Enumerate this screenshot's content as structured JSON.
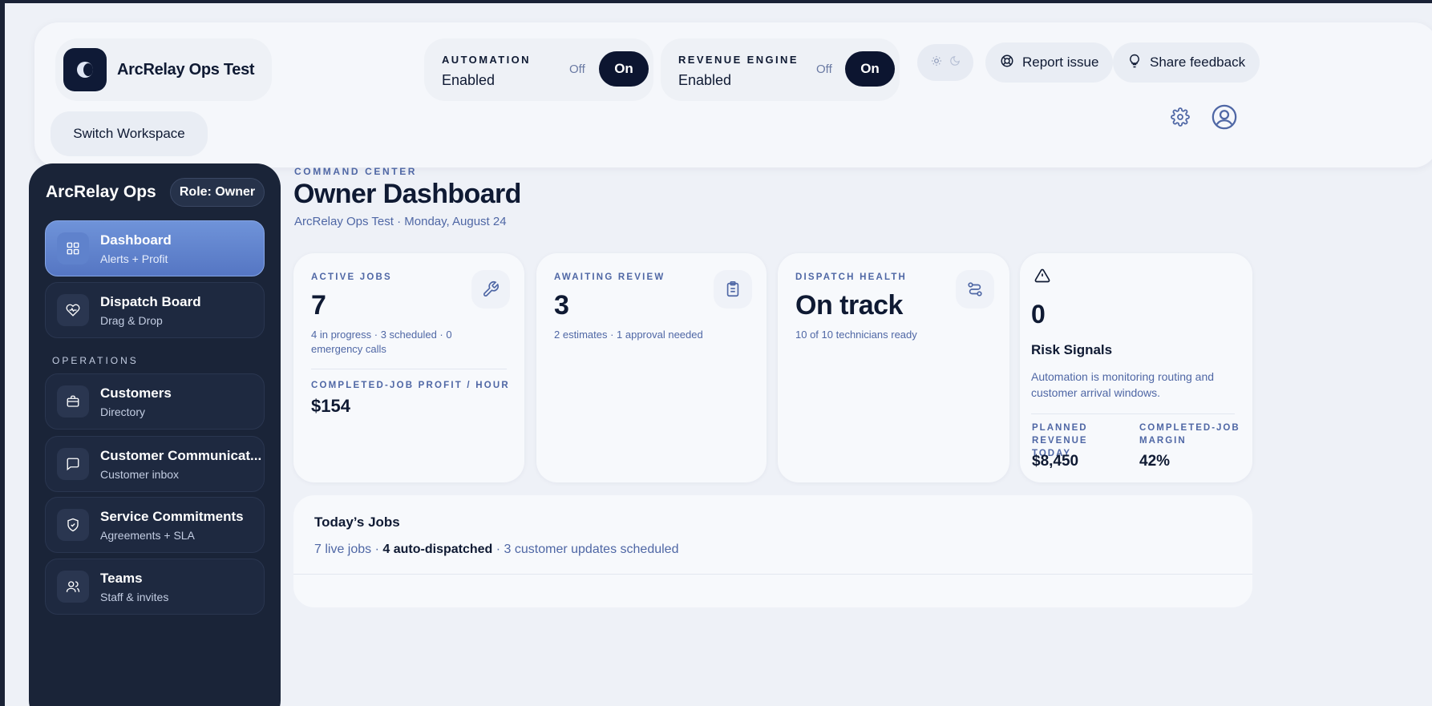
{
  "header": {
    "brand_name": "ArcRelay Ops Test",
    "switch_workspace": "Switch Workspace",
    "automation": {
      "label": "AUTOMATION",
      "status": "Enabled",
      "off": "Off",
      "on": "On"
    },
    "revenue_engine": {
      "label": "REVENUE ENGINE",
      "status": "Enabled",
      "off": "Off",
      "on": "On"
    },
    "report_issue": "Report issue",
    "share_feedback": "Share feedback"
  },
  "sidebar": {
    "title": "ArcRelay Ops",
    "role": "Role: Owner",
    "section_operations": "OPERATIONS",
    "items": [
      {
        "title": "Dashboard",
        "sub": "Alerts + Profit",
        "icon": "grid-icon"
      },
      {
        "title": "Dispatch Board",
        "sub": "Drag & Drop",
        "icon": "heart-pulse-icon"
      },
      {
        "title": "Customers",
        "sub": "Directory",
        "icon": "briefcase-icon"
      },
      {
        "title": "Customer Communicat...",
        "sub": "Customer inbox",
        "icon": "chat-icon"
      },
      {
        "title": "Service Commitments",
        "sub": "Agreements + SLA",
        "icon": "shield-check-icon"
      },
      {
        "title": "Teams",
        "sub": "Staff & invites",
        "icon": "users-icon"
      }
    ]
  },
  "main": {
    "eyebrow": "COMMAND CENTER",
    "title": "Owner Dashboard",
    "subtitle": "ArcRelay Ops Test · Monday, August 24",
    "cards": {
      "active_jobs": {
        "label": "ACTIVE JOBS",
        "value": "7",
        "desc": "4 in progress · 3 scheduled · 0 emergency calls",
        "label2": "COMPLETED-JOB PROFIT / HOUR",
        "value2": "$154"
      },
      "awaiting_review": {
        "label": "AWAITING REVIEW",
        "value": "3",
        "desc": "2 estimates · 1 approval needed"
      },
      "dispatch_health": {
        "label": "DISPATCH HEALTH",
        "value": "On track",
        "desc": "10 of 10 technicians ready"
      },
      "risk": {
        "value": "0",
        "title": "Risk Signals",
        "desc": "Automation is monitoring routing and customer arrival windows.",
        "planned_label": "PLANNED REVENUE TODAY",
        "planned_value": "$8,450",
        "margin_label": "COMPLETED-JOB MARGIN",
        "margin_value": "42%"
      }
    },
    "todays_jobs": {
      "title": "Today’s Jobs",
      "live": "7 live jobs",
      "auto_count": "4",
      "auto_label": "auto-dispatched",
      "updates": "3 customer updates scheduled"
    }
  }
}
